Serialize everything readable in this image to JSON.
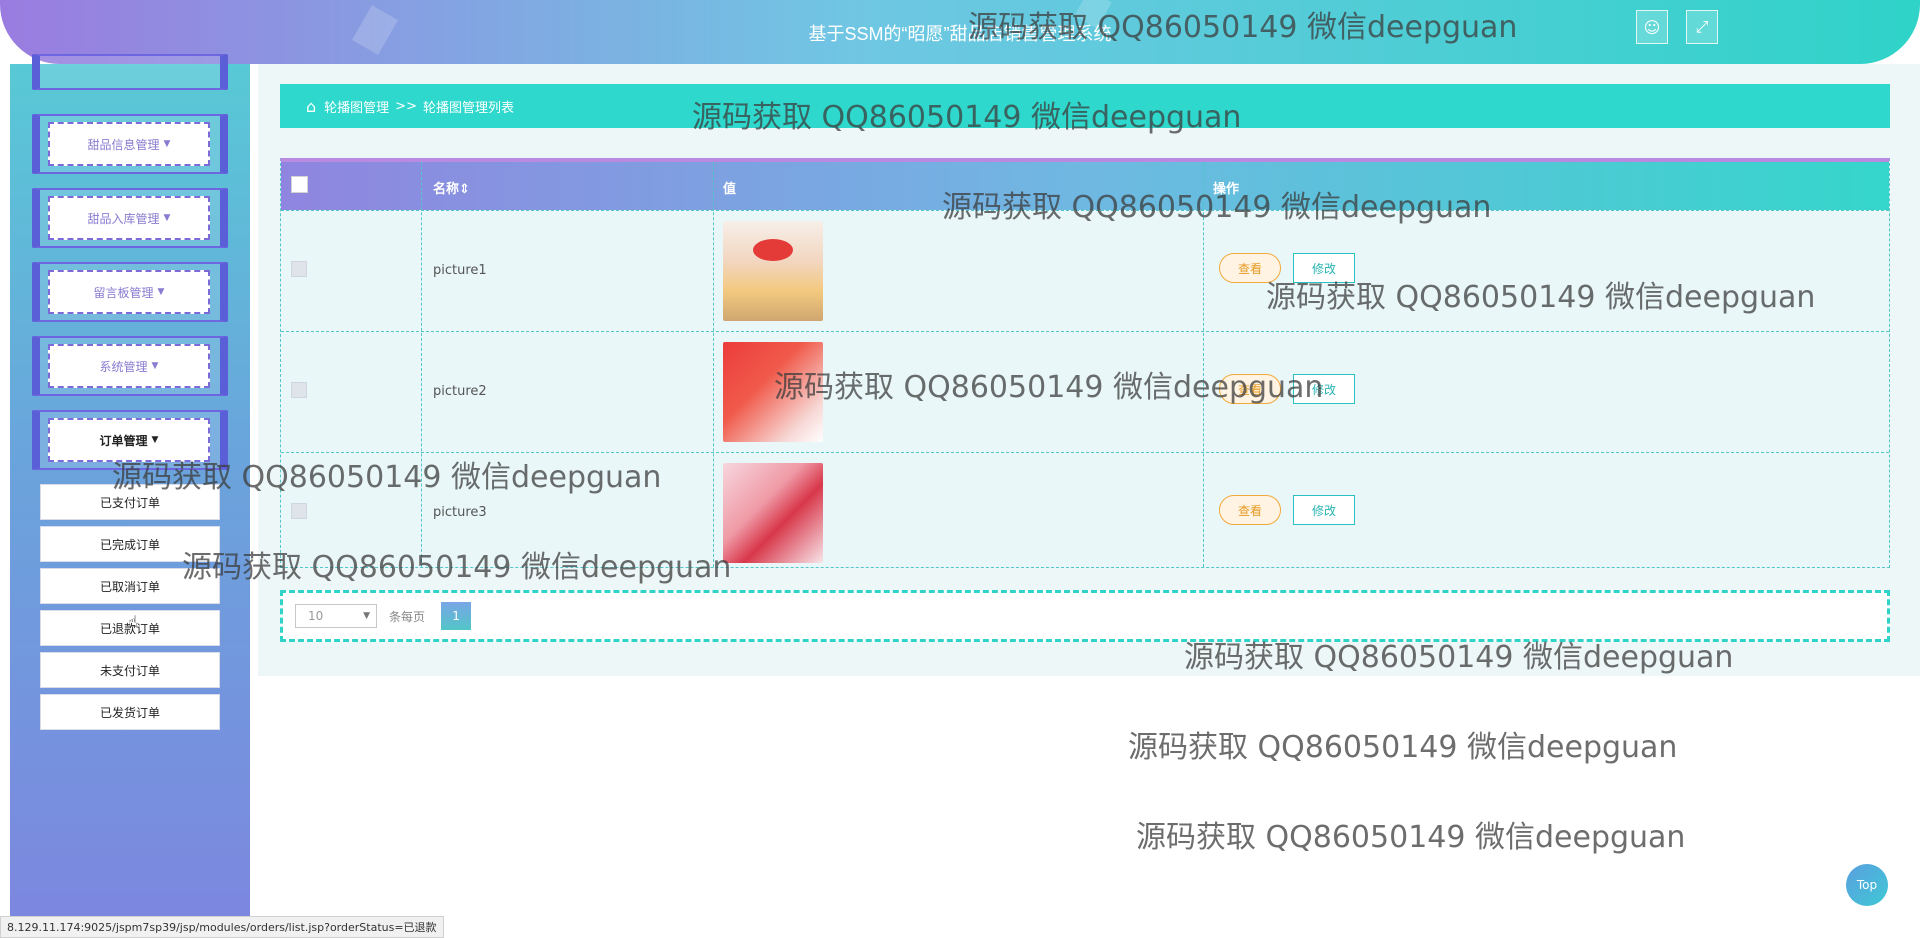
{
  "header": {
    "title": "基于SSM的“昭愿”甜品店销售管理系统"
  },
  "sidebar": {
    "groups": [
      {
        "label": "甜品信息管理"
      },
      {
        "label": "甜品入库管理"
      },
      {
        "label": "留言板管理"
      },
      {
        "label": "系统管理"
      },
      {
        "label": "订单管理"
      }
    ],
    "sub_items": [
      "已支付订单",
      "已完成订单",
      "已取消订单",
      "已退款订单",
      "未支付订单",
      "已发货订单"
    ]
  },
  "breadcrumb": {
    "section": "轮播图管理",
    "separator": ">>",
    "page": "轮播图管理列表"
  },
  "table": {
    "headers": {
      "name": "名称",
      "sort_indicator": "⇕",
      "value": "值",
      "actions": "操作"
    },
    "rows": [
      {
        "name": "picture1",
        "view_label": "查看",
        "edit_label": "修改"
      },
      {
        "name": "picture2",
        "view_label": "查看",
        "edit_label": "修改"
      },
      {
        "name": "picture3",
        "view_label": "查看",
        "edit_label": "修改"
      }
    ]
  },
  "pagination": {
    "page_size": "10",
    "per_page_label": "条每页",
    "current_page": "1"
  },
  "top_button": "Top",
  "status_url": "8.129.11.174:9025/jspm7sp39/jsp/modules/orders/list.jsp?orderStatus=已退款",
  "watermark": "源码获取 QQ86050149 微信deepguan",
  "colors": {
    "header_accent": "#2fd3c8",
    "sidebar": "#6aa4dc",
    "view_button": "#f2a93b",
    "edit_button": "#2cc0c0"
  },
  "icons": [
    "user-icon",
    "fullscreen-icon",
    "home-icon"
  ]
}
